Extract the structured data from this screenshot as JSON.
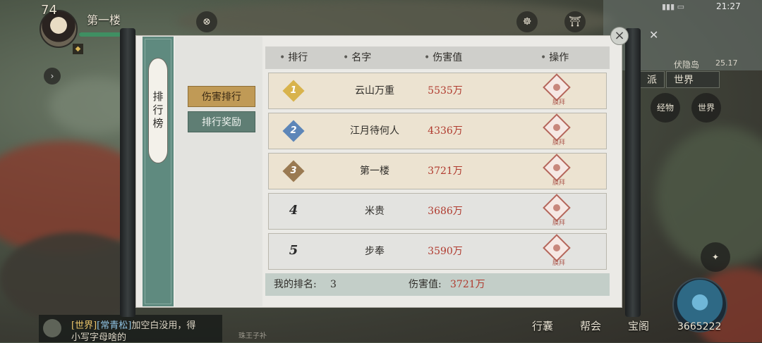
{
  "hud": {
    "level": "74",
    "player_name": "第一楼",
    "clock": "21:27",
    "location": "伏隐岛",
    "coords": "25.17",
    "faction_label": "派",
    "world_label": "世界",
    "side_btn_1": "经物",
    "side_btn_2": "世界",
    "power": "3665222",
    "nav": [
      "行囊",
      "帮会",
      "宝阁"
    ]
  },
  "chat": {
    "channel": "[世界]",
    "speaker": "[常青松]",
    "line1_text": "加空白没用，得",
    "line2_text": "小写字母啥的",
    "tag": "珠王子补"
  },
  "panel": {
    "title": "排行榜",
    "tabs": [
      {
        "label": "伤害排行",
        "active": true
      },
      {
        "label": "排行奖励",
        "active": false
      }
    ],
    "headers": {
      "rank": "排行",
      "name": "名字",
      "damage": "伤害值",
      "action": "操作"
    },
    "rows": [
      {
        "rank": "1",
        "name": "云山万重",
        "damage": "5535万",
        "action": "膜拜",
        "badge_color": "#d8b34c"
      },
      {
        "rank": "2",
        "name": "江月待何人",
        "damage": "4336万",
        "action": "膜拜",
        "badge_color": "#5d86b8"
      },
      {
        "rank": "3",
        "name": "第一楼",
        "damage": "3721万",
        "action": "膜拜",
        "badge_color": "#9a7a52"
      },
      {
        "rank": "4",
        "name": "米贵",
        "damage": "3686万",
        "action": "膜拜"
      },
      {
        "rank": "5",
        "name": "步奉",
        "damage": "3590万",
        "action": "膜拜"
      }
    ],
    "footer": {
      "my_rank_label": "我的排名:",
      "my_rank_value": "3",
      "my_damage_label": "伤害值:",
      "my_damage_value": "3721万"
    }
  }
}
